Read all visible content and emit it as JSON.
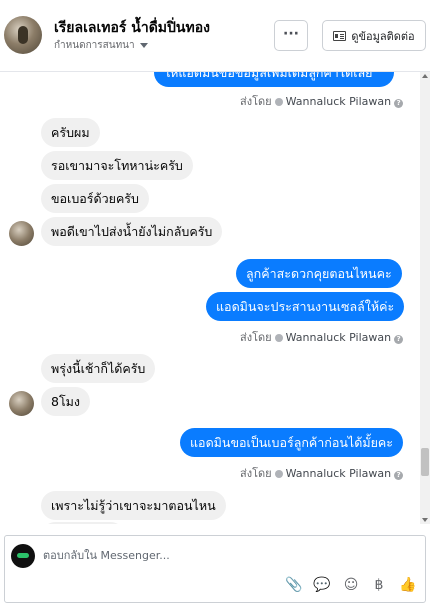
{
  "header": {
    "contact_name": "เรียลเลเทอร์ น้ำดื่มปิ่นทอง",
    "assign_label": "กำหนดการสนทนา",
    "more_label": "···",
    "contact_info_label": "ดูข้อมูลติดต่อ"
  },
  "thread": {
    "top_partial_message": "ให้แอดมินขอข้อมูลเพิ่มเติมลูกค้าได้เลย",
    "sent_by_prefix": "ส่งโดย",
    "sent_by_name": "Wannaluck Pilawan",
    "info_glyph": "?",
    "messages": [
      {
        "text": "ครับผม",
        "dir": "in"
      },
      {
        "text": "รอเขามาจะโทหาน่ะครับ",
        "dir": "in"
      },
      {
        "text": "ขอเบอร์ด้วยครับ",
        "dir": "in"
      },
      {
        "text": "พอดีเขาไปส่งน้ำยังไม่กลับครับ",
        "dir": "in"
      },
      {
        "text": "ลูกค้าสะดวกคุยตอนไหนคะ",
        "dir": "out"
      },
      {
        "text": "แอดมินจะประสานงานเซลล์ให้ค่ะ",
        "dir": "out"
      },
      {
        "text": "พรุ่งนี้เช้าก็ได้ครับ",
        "dir": "in"
      },
      {
        "text": "8โมง",
        "dir": "in"
      },
      {
        "text": "แอดมินขอเป็นเบอร์ลูกค้าก่อนได้มั้ยคะ",
        "dir": "out"
      },
      {
        "text": "เพราะไม่รู้ว่าเขาจะมาตอนไหน",
        "dir": "in"
      }
    ]
  },
  "composer": {
    "placeholder": "ตอบกลับใน Messenger...",
    "tools": [
      "attach-icon",
      "saved-reply-icon",
      "emoji-icon",
      "baht-icon",
      "like-icon"
    ],
    "tool_glyphs": [
      "📎",
      "💬",
      "☺",
      "฿",
      "👍"
    ]
  },
  "colors": {
    "outgoing_bubble": "#0a7cff",
    "incoming_bubble": "#f0f0f0"
  }
}
